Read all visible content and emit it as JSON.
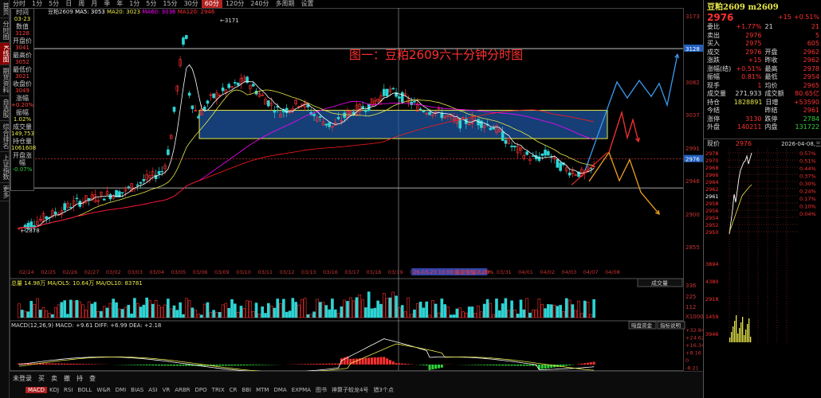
{
  "leftnav": [
    "首页",
    "分时图",
    "K线图",
    "期货资料",
    "自选股",
    "综合排名",
    "上证指数",
    "更多"
  ],
  "toolbar": [
    "分时",
    "1分",
    "5分",
    "日",
    "周",
    "月",
    "季",
    "年",
    "1分",
    "5分",
    "15分",
    "30分",
    "60分",
    "120分",
    "240分",
    "多周期",
    "设置"
  ],
  "toolbar_active_index": 12,
  "ma_line": {
    "symbol": "豆粕2609",
    "ma5": "MA5: 3053",
    "ma20": "MA20: 3023",
    "ma60": "MA60: 3036",
    "ma120": "MA120: 2946"
  },
  "chart_title": "图一：豆粕2609六十分钟分时图",
  "info_panel": [
    {
      "label": "时间",
      "value": "03-23",
      "cls": "y"
    },
    {
      "label": "数值",
      "value": "3128",
      "cls": ""
    },
    {
      "label": "开盘价",
      "value": "3041",
      "cls": ""
    },
    {
      "label": "最高价",
      "value": "3052",
      "cls": ""
    },
    {
      "label": "最低价",
      "value": "3021",
      "cls": ""
    },
    {
      "label": "收盘价",
      "value": "3049",
      "cls": ""
    },
    {
      "label": "涨幅",
      "value": "+0.20%",
      "cls": ""
    },
    {
      "label": "振幅",
      "value": "1.02%",
      "cls": "y"
    },
    {
      "label": "成交量",
      "value": "149,753",
      "cls": "y"
    },
    {
      "label": "持仓量",
      "value": "1061608",
      "cls": "y"
    },
    {
      "label": "开盘涨幅",
      "value": "-0.07%",
      "cls": "g"
    }
  ],
  "right_axis_labels": [
    "3173",
    "3128",
    "3082",
    "3037",
    "2991",
    "2976",
    "2946",
    "2900",
    "2855"
  ],
  "date_labels": [
    "02/24",
    "02/25",
    "02/26",
    "02/27",
    "03/02",
    "03/03",
    "03/04",
    "03/05",
    "03/06",
    "03/09",
    "03/10",
    "03/11",
    "03/12",
    "03/13",
    "03/16",
    "03/17",
    "03/18",
    "03/19",
    "03/20",
    "26-03-23 10:00 星分涨幅 2.20%",
    "03/27",
    "03/30",
    "03/31",
    "04/01",
    "04/02",
    "04/03",
    "04/07",
    "04/08"
  ],
  "high_label": "3171",
  "low_label": "2878",
  "volume_legend": {
    "total": "总量 14.98万",
    "ma5": "MA/OL5: 10.64万",
    "ma10": "MA/OL10: 83781"
  },
  "volume_axis": [
    "336",
    "225",
    "112",
    "X1000"
  ],
  "volume_btn": "成交量",
  "macd_legend": {
    "name": "MACD(12,26,9)",
    "macd": "MACD: +9.61",
    "diff": "DIFF: +6.99",
    "dea": "DEA: +2.18"
  },
  "macd_axis": [
    "+32.84",
    "+24.62",
    "+16.34",
    "+8.16",
    "0",
    "-8.21"
  ],
  "macd_btns": [
    "暗盘资金",
    "指标说明"
  ],
  "right_panel": {
    "title": "豆粕2609 m2609",
    "price": "2976",
    "chg": "+15",
    "pct": "+0.51%",
    "rows": [
      [
        "委比",
        "+1.77%",
        "21",
        "委差",
        "21"
      ],
      [
        "卖出",
        "2976",
        "",
        "",
        "5"
      ],
      [
        "买入",
        "2975",
        "",
        "",
        "605"
      ],
      [
        "成交",
        "2976",
        "开盘",
        "",
        "2962"
      ],
      [
        "涨跌",
        "+15",
        "昨收",
        "",
        "2962"
      ],
      [
        "涨幅(结)",
        "+0.51%",
        "最高",
        "",
        "2978"
      ],
      [
        "振幅",
        "0.81%",
        "最低",
        "",
        "2954"
      ],
      [
        "现手",
        "1",
        "均价",
        "",
        "2965"
      ],
      [
        "成交量",
        "271,933",
        "成交额",
        "",
        "80.65亿"
      ],
      [
        "持仓",
        "1828891",
        "日增",
        "",
        "+53590"
      ],
      [
        "今结",
        "",
        "昨结",
        "",
        "2961"
      ],
      [
        "涨停",
        "3130",
        "跌停",
        "",
        "2784"
      ],
      [
        "外盘",
        "140211",
        "内盘",
        "",
        "131722"
      ]
    ],
    "sub_title": "现价",
    "sub_price": "2976",
    "sub_date": "2026-04-08,三",
    "sub_axis": [
      "2978",
      "2970",
      "2968",
      "2966",
      "2964",
      "2962",
      "2961",
      "2958",
      "2956",
      "2954",
      "2952",
      "2950"
    ],
    "sub_pct": [
      "0.57%",
      "0.51%",
      "0.44%",
      "0.37%",
      "0.30%",
      "0.24%",
      "0.17%",
      "0.10%",
      "0.04%"
    ],
    "bottom_vals": [
      "3894",
      "4380",
      "2918",
      "1459",
      "3946"
    ]
  },
  "bottombar": {
    "tabs": [
      "MACD",
      "KDJ",
      "RSI",
      "BOLL",
      "W&R",
      "DMI",
      "BIAS",
      "ASI",
      "VR",
      "ARBR",
      "DPO",
      "TRIX",
      "CR",
      "BBI",
      "MTM",
      "DMA",
      "EXPMA",
      "图书",
      "神算子蛟龙4号",
      "猎3个点"
    ],
    "active": 0,
    "left": [
      "未登录",
      "买",
      "卖",
      "撤",
      "持",
      "查"
    ]
  },
  "colors": {
    "up": "#ff3030",
    "down": "#2fd4d4",
    "ma5": "#ffffff",
    "ma20": "#e8e84a",
    "ma60": "#ff00ff",
    "ma120": "#ff1a1a",
    "box": "#1e5aa8",
    "up_arrow": "#3a9bf0",
    "down_arrow": "#f0a020"
  }
}
